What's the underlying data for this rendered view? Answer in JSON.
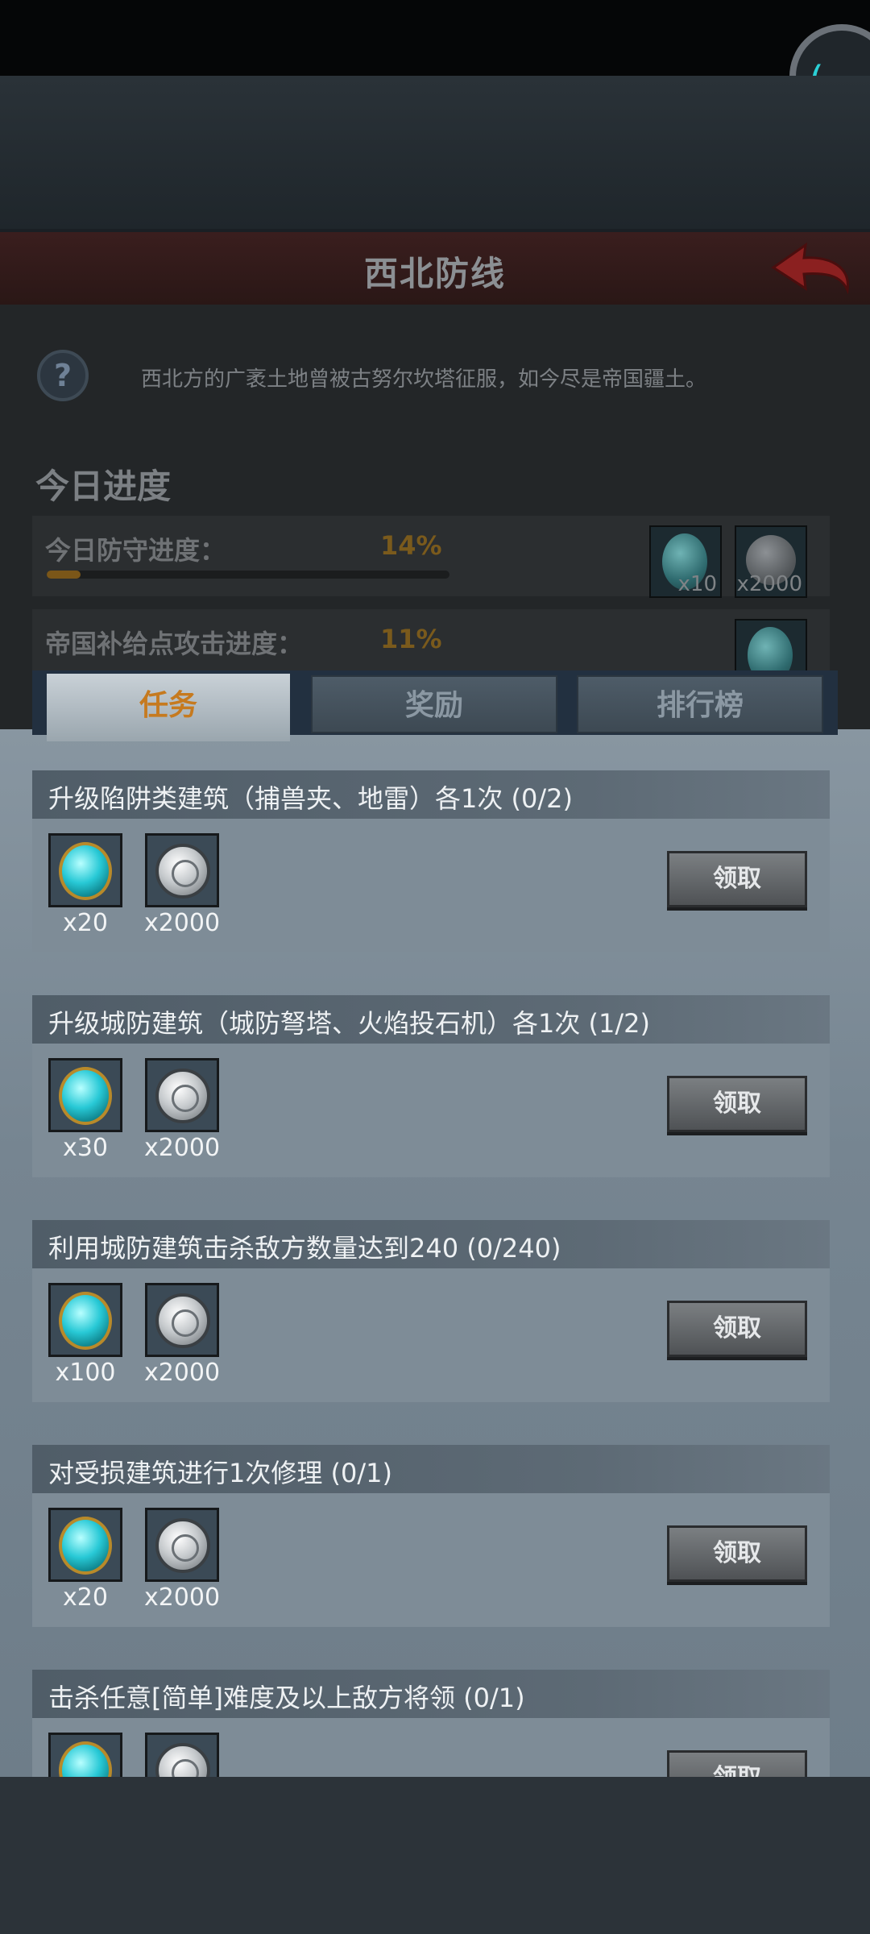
{
  "header": {
    "title": "西北防线",
    "description": "西北方的广袤土地曾被古努尔坎塔征服，如今尽是帝国疆土。"
  },
  "today": {
    "title": "今日进度",
    "rows": [
      {
        "label": "今日防守进度：",
        "percent_text": "14%",
        "progress": 0.14,
        "rewards": [
          {
            "icon": "gem-icon",
            "amount": "x10"
          },
          {
            "icon": "coin-icon",
            "amount": "x2000"
          }
        ]
      },
      {
        "label": "帝国补给点攻击进度：",
        "percent_text": "11%",
        "progress": 0.11,
        "rewards": [
          {
            "icon": "gem-icon",
            "amount": ""
          }
        ]
      }
    ]
  },
  "tabs": [
    {
      "label": "任务",
      "active": true
    },
    {
      "label": "奖励",
      "active": false
    },
    {
      "label": "排行榜",
      "active": false
    }
  ],
  "tasks": [
    {
      "title": "升级陷阱类建筑（捕兽夹、地雷）各1次 (0/2)",
      "gem_amount": "x20",
      "coin_amount": "x2000",
      "button": "领取"
    },
    {
      "title": "升级城防建筑（城防弩塔、火焰投石机）各1次 (1/2)",
      "gem_amount": "x30",
      "coin_amount": "x2000",
      "button": "领取"
    },
    {
      "title": "利用城防建筑击杀敌方数量达到240 (0/240)",
      "gem_amount": "x100",
      "coin_amount": "x2000",
      "button": "领取"
    },
    {
      "title": "对受损建筑进行1次修理 (0/1)",
      "gem_amount": "x20",
      "coin_amount": "x2000",
      "button": "领取"
    },
    {
      "title": "击杀任意[简单]难度及以上敌方将领 (0/1)",
      "gem_amount": "",
      "coin_amount": "",
      "button": "领取"
    }
  ],
  "colors": {
    "accent_tab": "#c67a1f",
    "gem": "#28c9d6",
    "panel": "#7e8c97"
  }
}
